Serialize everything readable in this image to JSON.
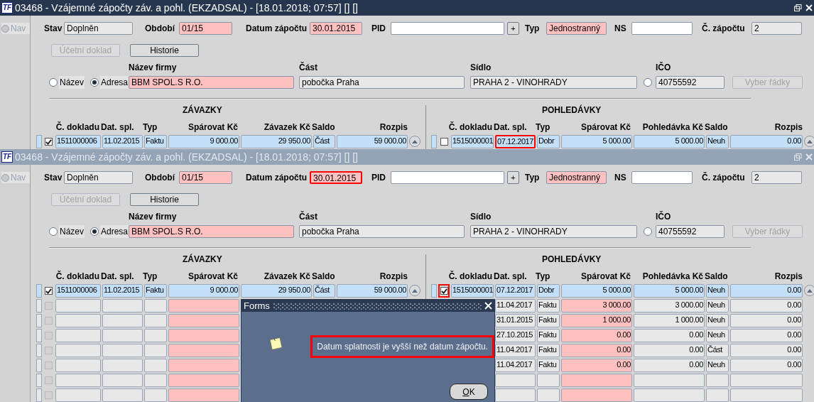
{
  "windows": [
    {
      "title": "03468 - Vzájemné zápočty záv. a pohl. (EKZADSAL) - [18.01.2018; 07:57] [] []",
      "logo": "TF",
      "active": true,
      "nav": {
        "label": "Nav",
        "disabled": true
      },
      "header_fields": [
        {
          "label": "Stav",
          "value": "Doplněn",
          "kind": "readonly",
          "highlighted": false
        },
        {
          "label": "Období",
          "value": "01/15",
          "kind": "required",
          "highlighted": false
        },
        {
          "label": "Datum zápočtu",
          "value": "30.01.2015",
          "kind": "required",
          "highlighted": false
        },
        {
          "label": "PID",
          "kind": "editable",
          "highlighted": false,
          "button": "+"
        },
        {
          "label": "Typ",
          "value": "Jednostranný",
          "kind": "required",
          "highlighted": false
        },
        {
          "label": "NS",
          "kind": "editable",
          "highlighted": false
        },
        {
          "label": "Č. zápočtu",
          "value": "2",
          "kind": "readonly",
          "highlighted": false
        }
      ],
      "buttons": [
        {
          "label": "Účetní doklad",
          "disabled": true
        },
        {
          "label": "Historie",
          "disabled": false
        }
      ],
      "search_by": [
        {
          "label": "Název",
          "selected": false
        },
        {
          "label": "Adresa",
          "selected": true
        }
      ],
      "company_fields": [
        {
          "label": "Název firmy",
          "value": "BBM SPOL.S R.O.",
          "kind": "required"
        },
        {
          "label": "Část",
          "value": "pobočka Praha",
          "kind": "readonly"
        },
        {
          "label": "Sídlo",
          "value": "PRAHA 2 - VINOHRADY",
          "kind": "readonly"
        },
        {
          "label": "IČO",
          "value": "40755592",
          "kind": "readonly",
          "radio_selected": false
        }
      ],
      "select_rows_button": {
        "label": "Vyber řádky",
        "disabled": true
      },
      "tables": [
        {
          "title": "ZÁVAZKY",
          "columns": [
            "Č. dokladu",
            "Dat. spl.",
            "Typ",
            "Spárovat Kč",
            "Závazek Kč",
            "Saldo",
            "Rozpis"
          ],
          "rows": [
            {
              "selected": true,
              "checked": true,
              "checkbox_highlighted": false,
              "doc": "1511000006",
              "due": "11.02.2015",
              "due_highlighted": false,
              "type": "Faktu",
              "match": "9 000.00",
              "amount": "29 950.00",
              "balance": "Část",
              "breakdown": "59 000.00"
            }
          ]
        },
        {
          "title": "POHLEDÁVKY",
          "columns": [
            "Č. dokladu",
            "Dat. spl.",
            "Typ",
            "Spárovat Kč",
            "Pohledávka Kč",
            "Saldo",
            "Rozpis"
          ],
          "rows": [
            {
              "selected": true,
              "checked": false,
              "checkbox_highlighted": false,
              "doc": "1515000001",
              "due": "07.12.2017",
              "due_highlighted": true,
              "type": "Dobr",
              "match": "5 000.00",
              "amount": "5 000.00",
              "balance": "Neuh",
              "breakdown": "0.00"
            }
          ]
        }
      ]
    },
    {
      "title": "03468 - Vzájemné zápočty záv. a pohl. (EKZADSAL) - [18.01.2018; 07:57] [] []",
      "logo": "TF",
      "active": false,
      "nav": {
        "label": "Nav",
        "disabled": true
      },
      "header_fields": [
        {
          "label": "Stav",
          "value": "Doplněn",
          "kind": "readonly",
          "highlighted": false
        },
        {
          "label": "Období",
          "value": "01/15",
          "kind": "required",
          "highlighted": false
        },
        {
          "label": "Datum zápočtu",
          "value": "30.01.2015",
          "kind": "required",
          "highlighted": true
        },
        {
          "label": "PID",
          "kind": "editable",
          "highlighted": false,
          "button": "+"
        },
        {
          "label": "Typ",
          "value": "Jednostranný",
          "kind": "required",
          "highlighted": false
        },
        {
          "label": "NS",
          "kind": "editable",
          "highlighted": false
        },
        {
          "label": "Č. zápočtu",
          "value": "2",
          "kind": "readonly",
          "highlighted": false
        }
      ],
      "buttons": [
        {
          "label": "Účetní doklad",
          "disabled": true
        },
        {
          "label": "Historie",
          "disabled": false
        }
      ],
      "search_by": [
        {
          "label": "Název",
          "selected": false
        },
        {
          "label": "Adresa",
          "selected": true
        }
      ],
      "company_fields": [
        {
          "label": "Název firmy",
          "value": "BBM SPOL.S R.O.",
          "kind": "required"
        },
        {
          "label": "Část",
          "value": "pobočka Praha",
          "kind": "readonly"
        },
        {
          "label": "Sídlo",
          "value": "PRAHA 2 - VINOHRADY",
          "kind": "readonly"
        },
        {
          "label": "IČO",
          "value": "40755592",
          "kind": "readonly",
          "radio_selected": false
        }
      ],
      "select_rows_button": {
        "label": "Vyber řádky",
        "disabled": true
      },
      "tables": [
        {
          "title": "ZÁVAZKY",
          "columns": [
            "Č. dokladu",
            "Dat. spl.",
            "Typ",
            "Spárovat Kč",
            "Závazek Kč",
            "Saldo",
            "Rozpis"
          ],
          "rows": [
            {
              "selected": true,
              "checked": true,
              "checkbox_highlighted": false,
              "doc": "1511000006",
              "due": "11.02.2015",
              "due_highlighted": false,
              "type": "Faktu",
              "match": "9 000.00",
              "amount": "29 950.00",
              "balance": "Část",
              "breakdown": "59 000.00"
            },
            {
              "selected": false,
              "checked": false,
              "checkbox_disabled": true
            },
            {
              "selected": false,
              "checked": false,
              "checkbox_disabled": true
            },
            {
              "selected": false,
              "checked": false,
              "checkbox_disabled": true
            },
            {
              "selected": false,
              "checked": false,
              "checkbox_disabled": true
            },
            {
              "selected": false,
              "checked": false,
              "checkbox_disabled": true
            },
            {
              "selected": false,
              "checked": false,
              "checkbox_disabled": true
            },
            {
              "selected": false,
              "checked": false,
              "checkbox_disabled": true
            }
          ]
        },
        {
          "title": "POHLEDÁVKY",
          "columns": [
            "Č. dokladu",
            "Dat. spl.",
            "Typ",
            "Spárovat Kč",
            "Pohledávka Kč",
            "Saldo",
            "Rozpis"
          ],
          "rows": [
            {
              "selected": true,
              "checked": true,
              "checkbox_highlighted": true,
              "doc": "1515000001",
              "due": "07.12.2017",
              "due_highlighted": false,
              "type": "Dobr",
              "match": "5 000.00",
              "amount": "5 000.00",
              "balance": "Neuh",
              "breakdown": "0.00"
            },
            {
              "selected": false,
              "due": "11.04.2017",
              "type": "Faktu",
              "match": "3 000.00",
              "amount": "3 000.00",
              "balance": "Neuh",
              "breakdown": "0.00"
            },
            {
              "selected": false,
              "due": "31.01.2015",
              "type": "Faktu",
              "match": "1 000.00",
              "amount": "1 000.00",
              "balance": "Neuh",
              "breakdown": "0.00"
            },
            {
              "selected": false,
              "due": "27.10.2015",
              "type": "Faktu",
              "match": "0.00",
              "amount": "0.00",
              "balance": "Neuh",
              "breakdown": "0.00"
            },
            {
              "selected": false,
              "due": "11.04.2017",
              "type": "Faktu",
              "match": "0.00",
              "amount": "0.00",
              "balance": "Část",
              "breakdown": "0.00"
            },
            {
              "selected": false,
              "due": "11.04.2017",
              "type": "Faktu",
              "match": "0.00",
              "amount": "0.00",
              "balance": "Neuh",
              "breakdown": "0.00"
            },
            {
              "selected": false
            },
            {
              "selected": false
            }
          ]
        }
      ]
    }
  ],
  "dialog": {
    "title": "Forms",
    "message": "Datum splatnosti je vyšší než datum zápočtu.",
    "highlighted": true,
    "button": "OK"
  }
}
